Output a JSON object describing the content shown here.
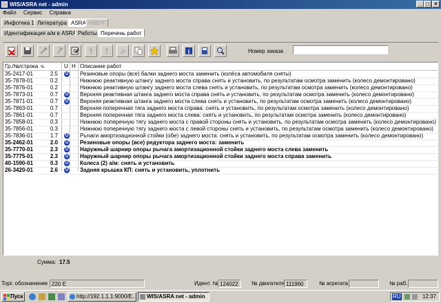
{
  "window": {
    "title": "WIS/ASRA net - admin"
  },
  "menu": [
    "Файл",
    "Сервис",
    "Справка"
  ],
  "tabs1": [
    {
      "label": "Инфотека 1",
      "active": false
    },
    {
      "label": "Литература",
      "active": false
    },
    {
      "label": "ASRA",
      "active": true
    },
    {
      "label": "ABBУГ",
      "active": false,
      "disabled": true
    }
  ],
  "tabs2": [
    {
      "label": "Идентификация а/м в ASRA",
      "active": false
    },
    {
      "label": "Работы",
      "active": false
    },
    {
      "label": "Перечень работ",
      "active": true
    }
  ],
  "order": {
    "label": "Номер заказа",
    "value": ""
  },
  "grid": {
    "headers": {
      "code": "Гр./№/строка",
      "h": "ч.",
      "u": "U",
      "n": "Н",
      "desc": "Описание работ"
    },
    "rows": [
      {
        "code": "35-2417-01",
        "h": "2.5",
        "u": true,
        "bold": false,
        "desc": "Резиновые опоры (все) балки заднего моста заменить (колёса автомобиля сняты)"
      },
      {
        "code": "35-7878-01",
        "h": "0.2",
        "u": false,
        "bold": false,
        "desc": "Нижнюю реактивную штангу заднего моста справа снять и установить, по результатам осмотра заменить (колесо демонтировано)"
      },
      {
        "code": "35-7876-01",
        "h": "0.2",
        "u": false,
        "bold": false,
        "desc": "Нижнюю реактивную штангу заднего моста слева снять и установить, по результатам осмотра заменить (колесо демонтировано)"
      },
      {
        "code": "35-7873-01",
        "h": "0.7",
        "u": true,
        "bold": false,
        "desc": "Верхняя реактивная штанга заднего моста справа снять и установить, по результатам осмотра заменить (колесо демонтировано)"
      },
      {
        "code": "35-7871-01",
        "h": "0.7",
        "u": true,
        "bold": false,
        "desc": "Верхняя реактивная штанга заднего моста слева снять и установить, по результатам осмотра заменить (колесо демонтировано)"
      },
      {
        "code": "35-7863-01",
        "h": "0.7",
        "u": false,
        "bold": false,
        "desc": "Верхняя поперечная тяга заднего моста справа: снять и установить, по результатам осмотра заменить (колесо демонтировано)"
      },
      {
        "code": "35-7861-01",
        "h": "0.7",
        "u": false,
        "bold": false,
        "desc": "Верхняя поперечная тяга заднего моста слева: снять и установить, по результатам осмотра заменить (колесо демонтировано)"
      },
      {
        "code": "35-7858-01",
        "h": "0.3",
        "u": false,
        "bold": false,
        "desc": "Нижнюю поперечную тягу заднего моста с правой стороны снять и установить, по результатам осмотра заменить (колесо демонтировано)"
      },
      {
        "code": "35-7856-01",
        "h": "0.3",
        "u": false,
        "bold": false,
        "desc": "Нижнюю поперечную тягу заднего моста с левой стороны снять и установить, по результатам осмотра заменить (колесо демонтировано)"
      },
      {
        "code": "35-7836-01",
        "h": "1.7",
        "u": true,
        "bold": false,
        "desc": "Рычаги амортизационной стойки (обе) заднего моста: снять и установить, по результатам осмотра заменить (колесо демонтировано)"
      },
      {
        "code": "35-2462-01",
        "h": "2.0",
        "u": true,
        "bold": true,
        "desc": "Резиновые опоры (все) редуктора заднего моста: заменить"
      },
      {
        "code": "35-7770-01",
        "h": "2.3",
        "u": true,
        "bold": true,
        "desc": "Наружный шарнир опоры рычага амортизационной стойки заднего моста слева заменить"
      },
      {
        "code": "35-7775-01",
        "h": "2.3",
        "u": true,
        "bold": true,
        "desc": "Наружный шарнир опоры рычага амортизационной стойки заднего моста справа заменить"
      },
      {
        "code": "40-1590-01",
        "h": "0.3",
        "u": true,
        "bold": true,
        "desc": "Колеса (2) а/м: снять и установить"
      },
      {
        "code": "26-3420-01",
        "h": "2.6",
        "u": true,
        "bold": true,
        "desc": "Задняя крышка КП: снять и установить, уплотнить"
      }
    ],
    "u_icon_letter": "U"
  },
  "summary": {
    "label": "Сумма:",
    "value": "17.5"
  },
  "status": {
    "torg_label": "Торг. обозначение",
    "torg_value": "220 E",
    "ident_label": "Идент. №",
    "ident_value": "124022",
    "engine_label": "№ двигателя",
    "engine_value": "111960",
    "agg_label": "№ агрегата",
    "agg_value": "",
    "rab_label": "№ раб.",
    "rab_value": ""
  },
  "taskbar": {
    "start": "Пуск",
    "tasks": [
      {
        "label": "http://192.1.1.1:9000/E...",
        "active": false
      },
      {
        "label": "WIS/ASRA net - admin",
        "active": true
      }
    ],
    "lang": "RU",
    "clock": "12:37"
  }
}
